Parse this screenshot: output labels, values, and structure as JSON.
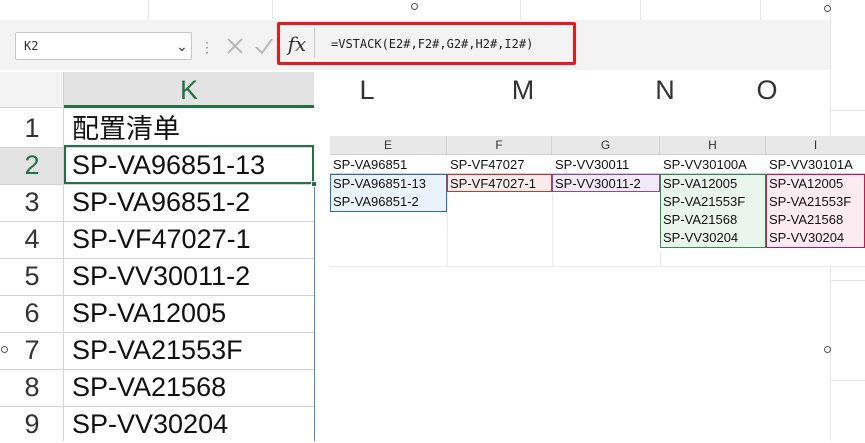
{
  "formula_bar": {
    "name_box": "K2",
    "fx_label": "fx",
    "formula": "=VSTACK(E2#,F2#,G2#,H2#,I2#)"
  },
  "columns": [
    "K",
    "L",
    "M",
    "N",
    "O"
  ],
  "rows": [
    "1",
    "2",
    "3",
    "4",
    "5",
    "6",
    "7",
    "8",
    "9"
  ],
  "column_k": {
    "header": "配置清单",
    "values": [
      "SP-VA96851-13",
      "SP-VA96851-2",
      "SP-VF47027-1",
      "SP-VV30011-2",
      "SP-VA12005",
      "SP-VA21553F",
      "SP-VA21568",
      "SP-VV30204"
    ]
  },
  "picture": {
    "columns": [
      "E",
      "F",
      "G",
      "H",
      "I"
    ],
    "headers": [
      "SP-VA96851",
      "SP-VF47027",
      "SP-VV30011",
      "SP-VV30100A",
      "SP-VV30101A"
    ],
    "col_e": [
      "SP-VA96851-13",
      "SP-VA96851-2"
    ],
    "col_f": [
      "SP-VF47027-1"
    ],
    "col_g": [
      "SP-VV30011-2"
    ],
    "col_h": [
      "SP-VA12005",
      "SP-VA21553F",
      "SP-VA21568",
      "SP-VV30204"
    ],
    "col_i": [
      "SP-VA12005",
      "SP-VA21553F",
      "SP-VA21568",
      "SP-VV30204"
    ]
  },
  "colors": {
    "accent_green": "#217346",
    "highlight_red": "#e21b1b",
    "spill_blue": "#2b6cb0",
    "spill_red": "#c0392b",
    "spill_purple": "#8e44ad",
    "spill_green": "#2e8b57",
    "spill_pink": "#c2185b"
  }
}
